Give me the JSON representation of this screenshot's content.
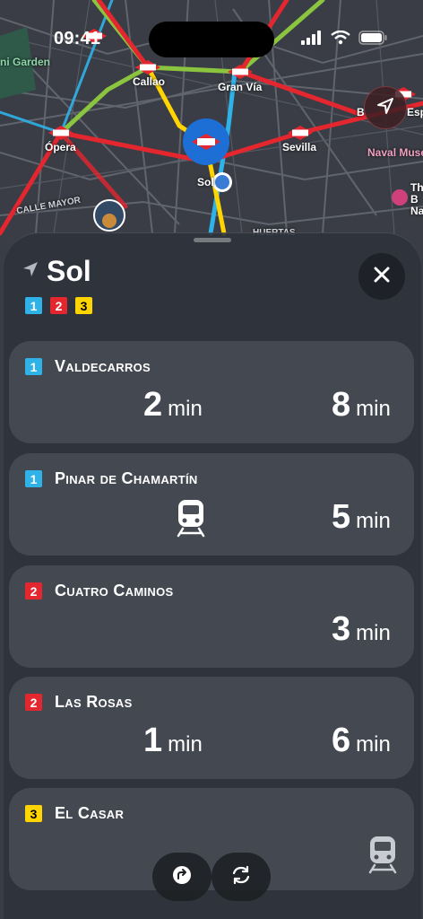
{
  "status": {
    "time": "09:41"
  },
  "map": {
    "labels": {
      "garden": "ni Garden",
      "callao": "Callao",
      "gran_via": "Gran Vía",
      "opera": "Ópera",
      "sevilla": "Sevilla",
      "sol": "Sol",
      "calle_mayor": "CALLE MAYOR",
      "naval": "Naval Muse",
      "esp": "Esp",
      "b": "B",
      "th": "Th",
      "b2": "B",
      "na": "Na",
      "huertas": "HUERTAS"
    },
    "metro_text": "Metro",
    "colors": {
      "line1": "#2fb2e8",
      "line2": "#e4262e",
      "line3": "#ffd400",
      "line5": "#8bc53f",
      "map_bg": "#3a3d45"
    }
  },
  "sheet": {
    "station": "Sol",
    "lines": [
      "1",
      "2",
      "3"
    ],
    "close_icon": "xmark-icon",
    "departures": [
      {
        "line": "1",
        "destination": "Valdecarros",
        "etas": [
          "2",
          "8"
        ],
        "unit": "min"
      },
      {
        "line": "1",
        "destination": "Pinar de Chamartín",
        "etas": [
          "5"
        ],
        "unit": "min",
        "arriving_icon": "train-icon"
      },
      {
        "line": "2",
        "destination": "Cuatro Caminos",
        "etas": [
          "3"
        ],
        "unit": "min"
      },
      {
        "line": "2",
        "destination": "Las Rosas",
        "etas": [
          "1",
          "6"
        ],
        "unit": "min"
      },
      {
        "line": "3",
        "destination": "El Casar",
        "etas": [],
        "unit": "min",
        "arriving_icon": "train-icon"
      }
    ],
    "bottom_buttons": [
      "directions-icon",
      "refresh-icon"
    ]
  }
}
